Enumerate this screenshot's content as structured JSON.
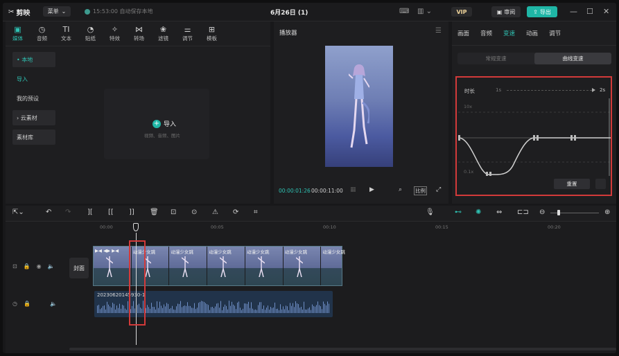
{
  "topbar": {
    "logo": "剪映",
    "menu": "菜单",
    "autosave": "15:53:00 自动保存本地",
    "project_title": "6月26日 (1)",
    "vip": "VIP",
    "review": "审阅",
    "export": "导出"
  },
  "media_tabs": [
    {
      "label": "媒体",
      "icon": "▣"
    },
    {
      "label": "音频",
      "icon": "◷"
    },
    {
      "label": "文本",
      "icon": "TI"
    },
    {
      "label": "贴纸",
      "icon": "◔"
    },
    {
      "label": "特效",
      "icon": "✧"
    },
    {
      "label": "转场",
      "icon": "⋈"
    },
    {
      "label": "滤镜",
      "icon": "❀"
    },
    {
      "label": "调节",
      "icon": "⚌"
    },
    {
      "label": "模板",
      "icon": "⊞"
    }
  ],
  "side_nav": {
    "local": "• 本地",
    "import": "导入",
    "presets": "我的预设",
    "cloud": "› 云素材",
    "library": "素材库"
  },
  "import_area": {
    "button": "导入",
    "hint": "视频、音频、图片"
  },
  "player": {
    "title": "播放器",
    "current_time": "00:00:01:26",
    "total_time": "00:00:11:00",
    "ratio": "比例"
  },
  "right_panel": {
    "tabs": [
      "画面",
      "音频",
      "变速",
      "动画",
      "调节"
    ],
    "active_tab": "变速",
    "modes": [
      "常规变速",
      "曲线变速"
    ],
    "active_mode": "曲线变速",
    "duration_label": "时长",
    "duration_min": "1s",
    "duration_max": "2s",
    "y_top": "10x",
    "y_bottom": "0.1x",
    "reset": "重置"
  },
  "timeline": {
    "ruler": [
      "00:00",
      "00:05",
      "00:10",
      "00:15",
      "00:20"
    ],
    "cover": "封面",
    "clip_label": "动漫少女跳",
    "clip_count": 7,
    "audio_name": "20230620145930-1"
  },
  "colors": {
    "accent": "#1fb6a6",
    "highlight_box": "#d33a3a"
  }
}
